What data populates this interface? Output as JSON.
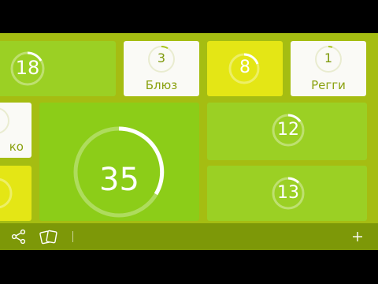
{
  "tiles": {
    "top_left": {
      "value": "18"
    },
    "blues": {
      "value": "3",
      "label": "Блюз"
    },
    "yellow": {
      "value": "8"
    },
    "reggae": {
      "value": "1",
      "label": "Регги"
    },
    "left_partial": {
      "label_fragment": "ко"
    },
    "big": {
      "value": "35"
    },
    "right_upper": {
      "value": "12"
    },
    "right_lower": {
      "value": "13"
    }
  },
  "toolbar": {
    "share_icon": "share-icon",
    "cards_icon": "cards-icon",
    "add_icon": "plus-icon"
  },
  "colors": {
    "background": "#a5bd12",
    "green": "#9bd024",
    "yellow": "#e4e615",
    "white": "#fafaf6",
    "toolbar": "#7d9808"
  }
}
